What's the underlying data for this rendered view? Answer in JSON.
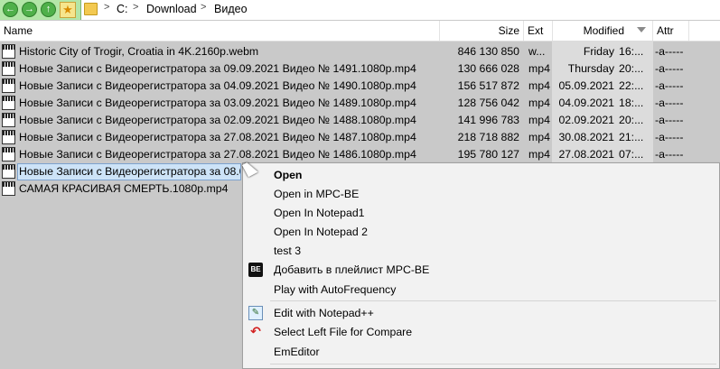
{
  "address": {
    "crumbs": [
      "C:",
      "Download",
      "Видео"
    ],
    "separator": ">"
  },
  "columns": {
    "name": "Name",
    "size": "Size",
    "ext": "Ext",
    "modified": "Modified",
    "attr": "Attr"
  },
  "files": [
    {
      "name": "Historic City of Trogir, Croatia in 4K.2160p.webm",
      "size": "846 130 850",
      "ext": "w...",
      "date": "Friday",
      "time": "16:...",
      "attr": "-a-----"
    },
    {
      "name": "Новые Записи с Видеорегистратора за 09.09.2021 Видео № 1491.1080p.mp4",
      "size": "130 666 028",
      "ext": "mp4",
      "date": "Thursday",
      "time": "20:...",
      "attr": "-a-----"
    },
    {
      "name": "Новые Записи с Видеорегистратора за 04.09.2021 Видео № 1490.1080p.mp4",
      "size": "156 517 872",
      "ext": "mp4",
      "date": "05.09.2021",
      "time": "22:...",
      "attr": "-a-----"
    },
    {
      "name": "Новые Записи с Видеорегистратора за 03.09.2021 Видео № 1489.1080p.mp4",
      "size": "128 756 042",
      "ext": "mp4",
      "date": "04.09.2021",
      "time": "18:...",
      "attr": "-a-----"
    },
    {
      "name": "Новые Записи с Видеорегистратора за 02.09.2021 Видео № 1488.1080p.mp4",
      "size": "141 996 783",
      "ext": "mp4",
      "date": "02.09.2021",
      "time": "20:...",
      "attr": "-a-----"
    },
    {
      "name": "Новые Записи с Видеорегистратора за 27.08.2021 Видео № 1487.1080p.mp4",
      "size": "218 718 882",
      "ext": "mp4",
      "date": "30.08.2021",
      "time": "21:...",
      "attr": "-a-----"
    },
    {
      "name": "Новые Записи с Видеорегистратора за 27.08.2021 Видео № 1486.1080p.mp4",
      "size": "195 780 127",
      "ext": "mp4",
      "date": "27.08.2021",
      "time": "07:...",
      "attr": "-a-----"
    },
    {
      "name": "Новые Записи с Видеорегистратора за 08.0",
      "size": "",
      "ext": "",
      "date": "",
      "time": "",
      "attr": "-a-----"
    },
    {
      "name": "САМАЯ КРАСИВАЯ СМЕРТЬ.1080p.mp4",
      "size": "",
      "ext": "",
      "date": "",
      "time": "",
      "attr": "-a-----"
    }
  ],
  "icon_label": "MPC",
  "menu": {
    "open": "Open",
    "open_mpc": "Open in MPC-BE",
    "open_notepad1": "Open In Notepad1",
    "open_notepad2": "Open In Notepad 2",
    "test3": "test 3",
    "add_playlist": "Добавить в плейлист MPC-BE",
    "play_autofreq": "Play with AutoFrequency",
    "edit_notepadpp": "Edit with Notepad++",
    "select_left": "Select Left File for Compare",
    "emeditor": "EmEditor",
    "mpc_icon_text": "BE"
  },
  "colors": {
    "topbar": "#b3e6a8",
    "selection": "#cde3f7",
    "menu_bg": "#f2f2f2"
  }
}
